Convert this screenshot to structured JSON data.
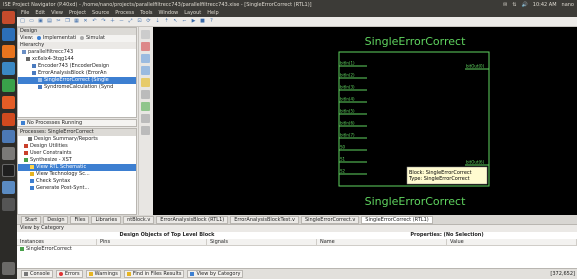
{
  "topbar": {
    "title": "ISE Project Navigator (P.40xd) - /home/nano/projects/parallelfiltrecc743/parallelfiltrecc743.xise - [SingleErrorCorrect (RTL1)]",
    "time": "10:42 AM",
    "user": "nano"
  },
  "menu": [
    "File",
    "Edit",
    "View",
    "Project",
    "Source",
    "Process",
    "Tools",
    "Window",
    "Layout",
    "Help"
  ],
  "design_panel": {
    "title": "Design",
    "view_impl": "View:",
    "impl_label": "Implementati",
    "sim_label": "Simulat",
    "hierarchy_title": "Hierarchy",
    "items": [
      "parallelfiltrecc743",
      "xc6slx4-3tqg144",
      "Encoder743 (EncoderDesign",
      "ErrorAnalysisBlock (ErrorAn",
      "SingleErrorCorrect (Single",
      "SyndromeCalculation (Synd"
    ]
  },
  "processes_panel": {
    "no_process": "No Processes Running",
    "title": "Processes: SingleErrorCorrect",
    "items": [
      "Design Summary/Reports",
      "Design Utilities",
      "User Constraints",
      "Synthesize - XST",
      "View RTL Schematic",
      "View Technology Sc...",
      "Check Syntax",
      "Generate Post-Synt..."
    ]
  },
  "schematic": {
    "top_label": "SingleErrorCorrect",
    "bottom_label": "SingleErrorCorrect",
    "left_pins": [
      "bitIn(1)",
      "bitIn(2)",
      "bitIn(3)",
      "bitIn(4)",
      "bitIn(5)",
      "bitIn(6)",
      "bitIn(7)",
      "S0",
      "S1",
      "S2"
    ],
    "right_pins": [
      "bitOut(0)",
      "bitOut(6)"
    ],
    "tooltip_line1": "Block: SingleErrorCorrect",
    "tooltip_line2": "Type: SingleErrorCorrect"
  },
  "tabs": [
    {
      "label": "Start",
      "active": false
    },
    {
      "label": "Design",
      "active": false
    },
    {
      "label": "Files",
      "active": false
    },
    {
      "label": "Libraries",
      "active": false
    },
    {
      "label": "ntBlock.v",
      "active": false
    },
    {
      "label": "ErrorAnalysisBlock (RTL1)",
      "active": false
    },
    {
      "label": "ErrorAnalysisBlockTest.v",
      "active": false
    },
    {
      "label": "SingleErrorCorrect.v",
      "active": false
    },
    {
      "label": "SingleErrorCorrect (RTL1)",
      "active": true
    }
  ],
  "bottom": {
    "view_by": "View by Category",
    "design_objects": "Design Objects of Top Level Block",
    "properties": "Properties: (No Selection)",
    "col_instances": "Instances",
    "col_pins": "Pins",
    "col_signals": "Signals",
    "col_name": "Name",
    "col_value": "Value",
    "instance_row": "SingleErrorCorrect"
  },
  "statusbar": {
    "console": "Console",
    "errors": "Errors",
    "warnings": "Warnings",
    "find": "Find in Files Results",
    "view_by_cat": "View by Category",
    "coords": "[372,652]"
  }
}
